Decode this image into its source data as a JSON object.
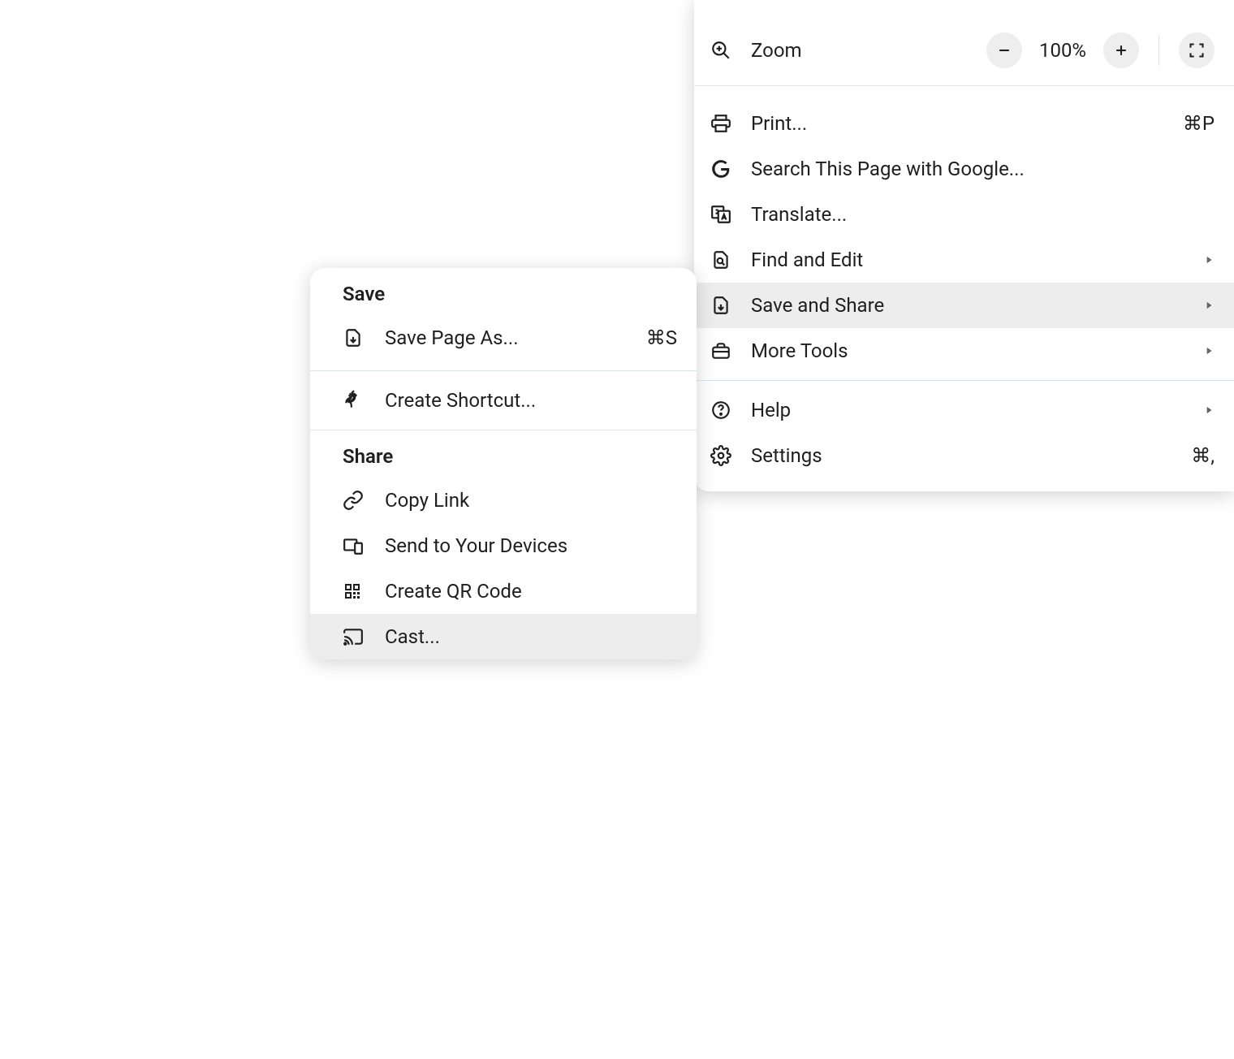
{
  "zoom": {
    "label": "Zoom",
    "value": "100%"
  },
  "menu": {
    "print": {
      "label": "Print...",
      "shortcut": "⌘P"
    },
    "search": {
      "label": "Search This Page with Google..."
    },
    "translate": {
      "label": "Translate..."
    },
    "find_edit": {
      "label": "Find and Edit"
    },
    "save_share": {
      "label": "Save and Share"
    },
    "more_tools": {
      "label": "More Tools"
    },
    "help": {
      "label": "Help"
    },
    "settings": {
      "label": "Settings",
      "shortcut": "⌘,"
    }
  },
  "submenu": {
    "save_header": "Save",
    "save_page": {
      "label": "Save Page As...",
      "shortcut": "⌘S"
    },
    "create_shortcut": {
      "label": "Create Shortcut..."
    },
    "share_header": "Share",
    "copy_link": {
      "label": "Copy Link"
    },
    "send_devices": {
      "label": "Send to Your Devices"
    },
    "qr_code": {
      "label": "Create QR Code"
    },
    "cast": {
      "label": "Cast..."
    }
  }
}
